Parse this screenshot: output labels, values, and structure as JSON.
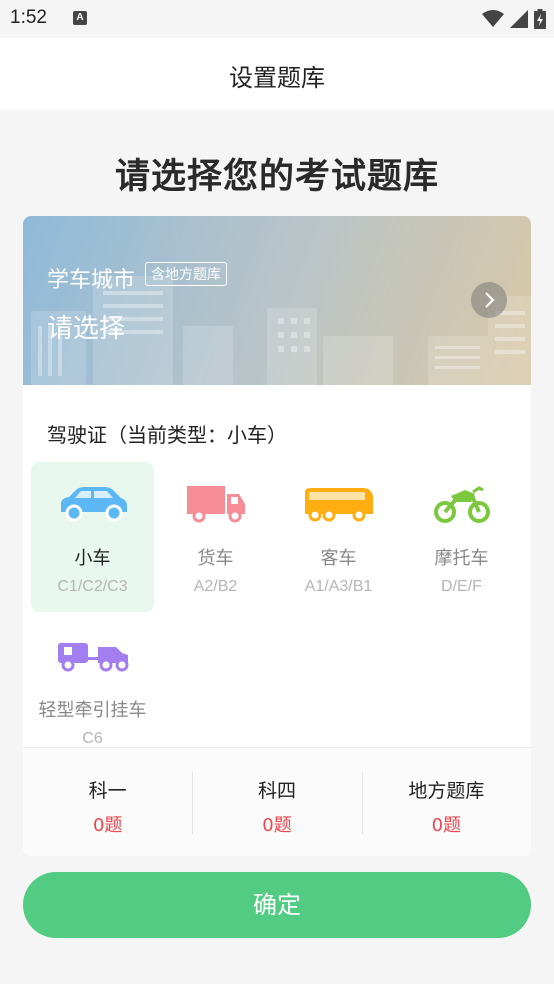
{
  "status_bar": {
    "time": "1:52",
    "notification_letter": "A"
  },
  "navbar": {
    "title": "设置题库"
  },
  "heading": "请选择您的考试题库",
  "banner": {
    "city_label": "学车城市",
    "region_tag": "含地方题库",
    "select_label": "请选择"
  },
  "license": {
    "title": "驾驶证（当前类型：小车）",
    "vehicles": [
      {
        "name": "小车",
        "codes": "C1/C2/C3",
        "selected": true,
        "icon": "car-icon",
        "color": "#5bb8f5"
      },
      {
        "name": "货车",
        "codes": "A2/B2",
        "selected": false,
        "icon": "truck-icon",
        "color": "#f58c96"
      },
      {
        "name": "客车",
        "codes": "A1/A3/B1",
        "selected": false,
        "icon": "bus-icon",
        "color": "#ffae12"
      },
      {
        "name": "摩托车",
        "codes": "D/E/F",
        "selected": false,
        "icon": "motorcycle-icon",
        "color": "#7bc83c"
      },
      {
        "name": "轻型牵引挂车",
        "codes": "C6",
        "selected": false,
        "icon": "trailer-icon",
        "color": "#a27ef0"
      }
    ]
  },
  "stats": [
    {
      "label": "科一",
      "count": "0题"
    },
    {
      "label": "科四",
      "count": "0题"
    },
    {
      "label": "地方题库",
      "count": "0题"
    }
  ],
  "confirm_label": "确定",
  "colors": {
    "accent": "#52cc83",
    "count_red": "#e9474d",
    "selected_bg": "#e8f8ee"
  }
}
